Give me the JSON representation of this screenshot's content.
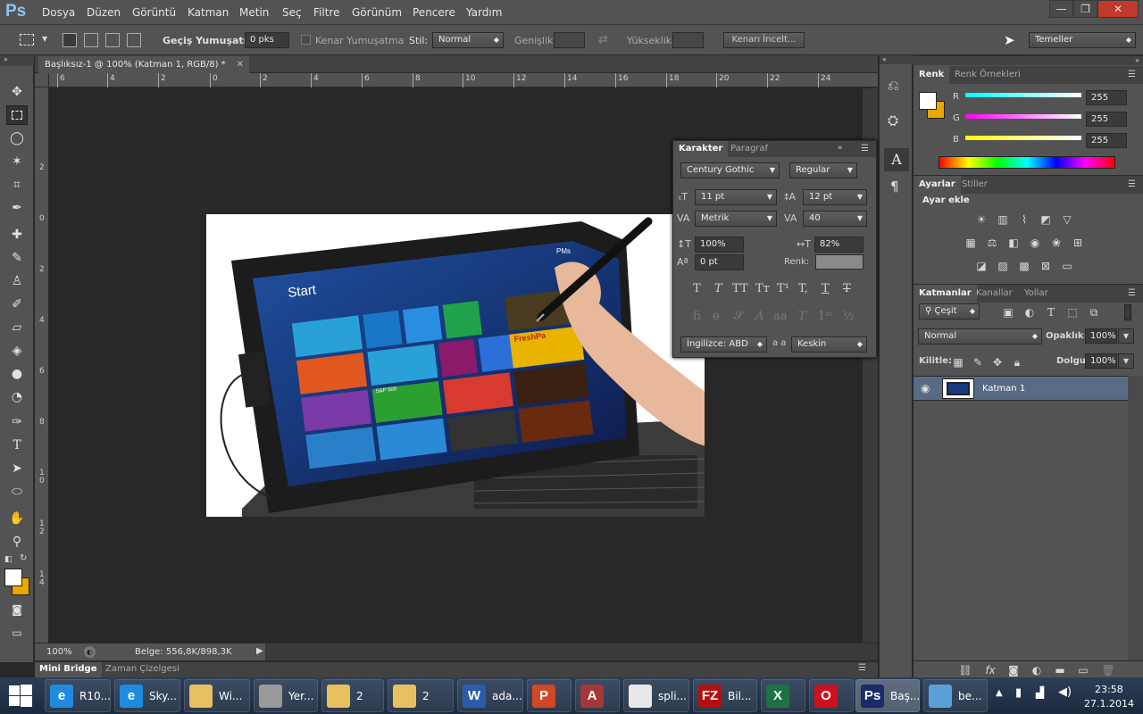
{
  "app": {
    "logo": "Ps"
  },
  "menu": [
    "Dosya",
    "Düzen",
    "Görüntü",
    "Katman",
    "Metin",
    "Seç",
    "Filtre",
    "Görünüm",
    "Pencere",
    "Yardım"
  ],
  "window_controls": {
    "minimize": "—",
    "restore": "❐",
    "close": "✕"
  },
  "options": {
    "feather_label": "Geçiş Yumuşatma:",
    "feather_value": "0 pks",
    "antialias_label": "Kenar Yumuşatma",
    "style_label": "Stil:",
    "style_value": "Normal",
    "width_label": "Genişlik:",
    "height_label": "Yükseklik:",
    "refine_button": "Kenarı İncelt...",
    "workspace": "Temeller"
  },
  "document": {
    "tab_title": "Başlıksız-1 @ 100% (Katman 1, RGB/8) *",
    "zoom": "100%",
    "doc_info": "Belge: 556,8K/898,3K",
    "ruler_h": [
      "6",
      "4",
      "2",
      "0",
      "2",
      "4",
      "6",
      "8",
      "10",
      "12",
      "14",
      "16",
      "18",
      "20",
      "22",
      "24"
    ],
    "ruler_v": [
      "2",
      "0",
      "2",
      "4",
      "6",
      "8",
      "1\n0",
      "1\n2",
      "1\n4"
    ]
  },
  "image_content": {
    "screen_title": "Start",
    "user": "PMs",
    "tile_text": [
      "S&P 500",
      "FreshPa"
    ]
  },
  "bottom_tabs": {
    "mini_bridge": "Mini Bridge",
    "timeline": "Zaman Çizelgesi"
  },
  "character": {
    "tab_active": "Karakter",
    "tab_other": "Paragraf",
    "font_family": "Century Gothic",
    "font_style": "Regular",
    "font_size": "11 pt",
    "leading": "12 pt",
    "kerning": "Metrik",
    "tracking": "40",
    "vertical_scale": "100%",
    "horizontal_scale": "82%",
    "baseline_shift": "0 pt",
    "color_label": "Renk:",
    "language": "İngilizce: ABD",
    "antialias": "Keskin",
    "aa_icon": "a a"
  },
  "color_panel": {
    "tab_active": "Renk",
    "tab_other": "Renk Örnekleri",
    "r_label": "R",
    "g_label": "G",
    "b_label": "B",
    "r": "255",
    "g": "255",
    "b": "255"
  },
  "adjustments": {
    "tab_active": "Ayarlar",
    "tab_other": "Stiller",
    "heading": "Ayar ekle"
  },
  "layers": {
    "tab_active": "Katmanlar",
    "tab_channels": "Kanallar",
    "tab_paths": "Yollar",
    "filter": "Çeşit",
    "blend_mode": "Normal",
    "opacity_label": "Opaklık:",
    "opacity": "100%",
    "lock_label": "Kilitle:",
    "fill_label": "Dolgu:",
    "fill": "100%",
    "layer_name": "Katman 1"
  },
  "taskbar": {
    "items": [
      {
        "label": "R10...",
        "icon": "e"
      },
      {
        "label": "Sky...",
        "icon": "e"
      },
      {
        "label": "Wi...",
        "icon": ""
      },
      {
        "label": "Yer...",
        "icon": ""
      },
      {
        "label": "2",
        "icon": ""
      },
      {
        "label": "2",
        "icon": ""
      },
      {
        "label": "ada...",
        "icon": "W"
      },
      {
        "label": "",
        "icon": "P"
      },
      {
        "label": "",
        "icon": "A"
      },
      {
        "label": "spli...",
        "icon": ""
      },
      {
        "label": "Bil...",
        "icon": "FZ"
      },
      {
        "label": "",
        "icon": "X"
      },
      {
        "label": "",
        "icon": "O"
      },
      {
        "label": "Baş...",
        "icon": "Ps"
      },
      {
        "label": "be...",
        "icon": ""
      }
    ],
    "time": "23:58",
    "date": "27.1.2014"
  }
}
